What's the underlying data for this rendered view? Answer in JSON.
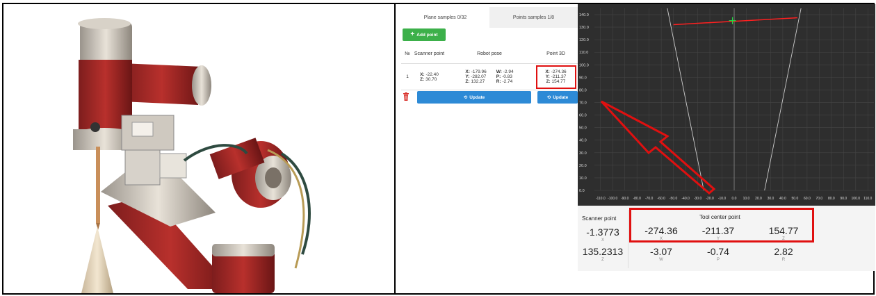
{
  "tabs": [
    "Plane samples 0/32",
    "Points samples 1/8"
  ],
  "add_point": "Add point",
  "table": {
    "headers": [
      "№",
      "Scanner point",
      "Robot pose",
      "Point 3D"
    ],
    "row": {
      "num": "1",
      "scanner": {
        "x_label": "X:",
        "x": "-22.40",
        "z_label": "Z:",
        "z": "30.70"
      },
      "pose": {
        "x_label": "X:",
        "x": "-179.96",
        "y_label": "Y:",
        "y": "-282.07",
        "z_label": "Z:",
        "z": "132.27",
        "w_label": "W:",
        "w": "-2.94",
        "p_label": "P:",
        "p": "-0.83",
        "r_label": "R:",
        "r": "-2.74"
      },
      "point3d": {
        "x_label": "X:",
        "x": "-274.36",
        "y_label": "Y:",
        "y": "-211.37",
        "z_label": "Z:",
        "z": "154.77"
      }
    }
  },
  "update_label": "Update",
  "plot": {
    "y_ticks": [
      "140.0",
      "130.0",
      "120.0",
      "110.0",
      "100.0",
      "90.0",
      "80.0",
      "70.0",
      "60.0",
      "50.0",
      "40.0",
      "30.0",
      "20.0",
      "10.0",
      "0.0"
    ],
    "x_ticks": [
      "-110.0",
      "-100.0",
      "-90.0",
      "-80.0",
      "-70.0",
      "-60.0",
      "-50.0",
      "-40.0",
      "-30.0",
      "-20.0",
      "-10.0",
      "0.0",
      "10.0",
      "20.0",
      "30.0",
      "40.0",
      "50.0",
      "60.0",
      "70.0",
      "80.0",
      "90.0",
      "100.0",
      "110.0"
    ],
    "colors": {
      "bg": "#2e2e2e",
      "line": "#ff2020",
      "marker": "#22dd44",
      "grid": "#444444",
      "fov": "#cccccc"
    }
  },
  "readout": {
    "scanner_title": "Scanner point",
    "tcp_title": "Tool center point",
    "scanner_x": "-1.3773",
    "scanner_x_label": "X",
    "scanner_z": "135.2313",
    "scanner_z_label": "Z",
    "tcp": [
      {
        "value": "-274.36",
        "label": "X"
      },
      {
        "value": "-211.37",
        "label": "Y"
      },
      {
        "value": "154.77",
        "label": "Z"
      },
      {
        "value": "-3.07",
        "label": "W"
      },
      {
        "value": "-0.74",
        "label": "P"
      },
      {
        "value": "2.82",
        "label": "R"
      }
    ]
  }
}
